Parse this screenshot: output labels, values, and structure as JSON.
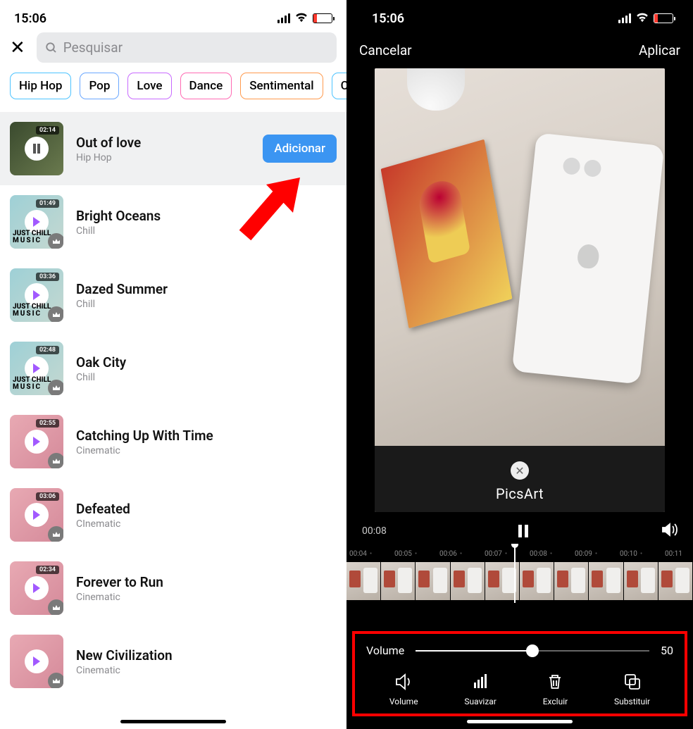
{
  "status": {
    "time": "15:06"
  },
  "search": {
    "placeholder": "Pesquisar"
  },
  "chips": [
    "Hip Hop",
    "Pop",
    "Love",
    "Dance",
    "Sentimental",
    "Ch"
  ],
  "songs": [
    {
      "title": "Out of love",
      "genre": "Hip Hop",
      "duration": "02:14",
      "selected": true,
      "premium": false,
      "thumb": "group"
    },
    {
      "title": "Bright Oceans",
      "genre": "Chill",
      "duration": "01:49",
      "selected": false,
      "premium": true,
      "thumb": "teal"
    },
    {
      "title": "Dazed Summer",
      "genre": "Chill",
      "duration": "03:36",
      "selected": false,
      "premium": true,
      "thumb": "teal"
    },
    {
      "title": "Oak City",
      "genre": "Chill",
      "duration": "02:48",
      "selected": false,
      "premium": true,
      "thumb": "teal"
    },
    {
      "title": "Catching Up With Time",
      "genre": "Cinematic",
      "duration": "02:55",
      "selected": false,
      "premium": true,
      "thumb": "pink"
    },
    {
      "title": "Defeated",
      "genre": "CInematic",
      "duration": "03:06",
      "selected": false,
      "premium": true,
      "thumb": "pink"
    },
    {
      "title": "Forever to Run",
      "genre": "Cinematic",
      "duration": "02:34",
      "selected": false,
      "premium": true,
      "thumb": "pink"
    },
    {
      "title": "New Civilization",
      "genre": "Cinematic",
      "duration": "",
      "selected": false,
      "premium": true,
      "thumb": "pink"
    }
  ],
  "add_button": "Adicionar",
  "thumb_label": "JUST CHILL",
  "thumb_sub": "MUSIC",
  "editor": {
    "cancel": "Cancelar",
    "apply": "Aplicar",
    "current_time": "00:08",
    "watermark": "PicsArt",
    "ruler": [
      "00:04",
      "00:05",
      "00:06",
      "00:07",
      "00:08",
      "00:09",
      "00:10",
      "00:11"
    ],
    "volume_label": "Volume",
    "volume_value": "50",
    "tools": [
      {
        "name": "Volume",
        "icon": "volume"
      },
      {
        "name": "Suavizar",
        "icon": "suavizar"
      },
      {
        "name": "Excluir",
        "icon": "excluir"
      },
      {
        "name": "Substituir",
        "icon": "substituir"
      }
    ]
  }
}
